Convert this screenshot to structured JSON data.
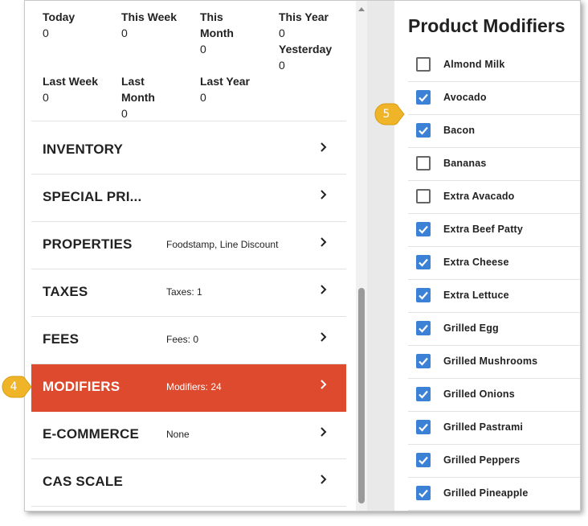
{
  "stats": [
    {
      "label": "Today",
      "value": "0"
    },
    {
      "label": "This Week",
      "value": "0"
    },
    {
      "label": "This Month",
      "value": "0"
    },
    {
      "label": "This Year",
      "value": "0"
    },
    {
      "label": "Yesterday",
      "value": "0"
    },
    {
      "label": "Last Week",
      "value": "0"
    },
    {
      "label": "Last Month",
      "value": "0"
    },
    {
      "label": "Last Year",
      "value": "0"
    }
  ],
  "rows": [
    {
      "title": "INVENTORY",
      "detail": ""
    },
    {
      "title": "SPECIAL PRI...",
      "detail": ""
    },
    {
      "title": "PROPERTIES",
      "detail": "Foodstamp, Line Discount"
    },
    {
      "title": "TAXES",
      "detail": "Taxes: 1"
    },
    {
      "title": "FEES",
      "detail": "Fees: 0"
    },
    {
      "title": "MODIFIERS",
      "detail": "Modifiers: 24"
    },
    {
      "title": "E-COMMERCE",
      "detail": "None"
    },
    {
      "title": "CAS SCALE",
      "detail": ""
    }
  ],
  "active_row": "MODIFIERS",
  "right_panel": {
    "title": "Product Modifiers",
    "modifiers": [
      {
        "name": "Almond Milk",
        "checked": false
      },
      {
        "name": "Avocado",
        "checked": true
      },
      {
        "name": "Bacon",
        "checked": true
      },
      {
        "name": "Bananas",
        "checked": false
      },
      {
        "name": "Extra Avacado",
        "checked": false
      },
      {
        "name": "Extra Beef Patty",
        "checked": true
      },
      {
        "name": "Extra Cheese",
        "checked": true
      },
      {
        "name": "Extra Lettuce",
        "checked": true
      },
      {
        "name": "Grilled Egg",
        "checked": true
      },
      {
        "name": "Grilled Mushrooms",
        "checked": true
      },
      {
        "name": "Grilled Onions",
        "checked": true
      },
      {
        "name": "Grilled Pastrami",
        "checked": true
      },
      {
        "name": "Grilled Peppers",
        "checked": true
      },
      {
        "name": "Grilled Pineapple",
        "checked": true
      }
    ]
  },
  "callouts": [
    {
      "label": "4"
    },
    {
      "label": "5"
    }
  ],
  "colors": {
    "active_row": "#dd4a2e",
    "checkbox_on": "#3b82d6",
    "callout": "#f0b429"
  }
}
